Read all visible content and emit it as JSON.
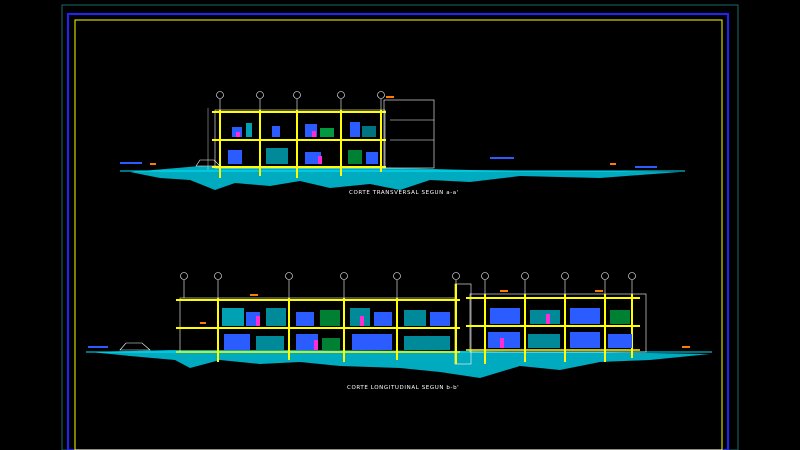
{
  "drawing": {
    "background": "#000000",
    "colors": {
      "outer_frame": "#1a6a6a",
      "border_blue": "#2222ff",
      "border_yellow": "#ffff00",
      "terrain": "#00e5ff",
      "structure": "#ffff00",
      "walls": "#ffffff",
      "furniture_blue": "#2a5cff",
      "furniture_magenta": "#ff2bd6",
      "furniture_green": "#00ff66",
      "accents_orange": "#ff7a00",
      "axis_markers": "#ffffff"
    }
  },
  "sections": {
    "transversal": {
      "caption": "CORTE TRANSVERSAL SEGUN a-a'",
      "axis_count": 5
    },
    "longitudinal": {
      "caption": "CORTE LONGITUDINAL SEGUN b-b'",
      "axis_count": 11
    }
  }
}
